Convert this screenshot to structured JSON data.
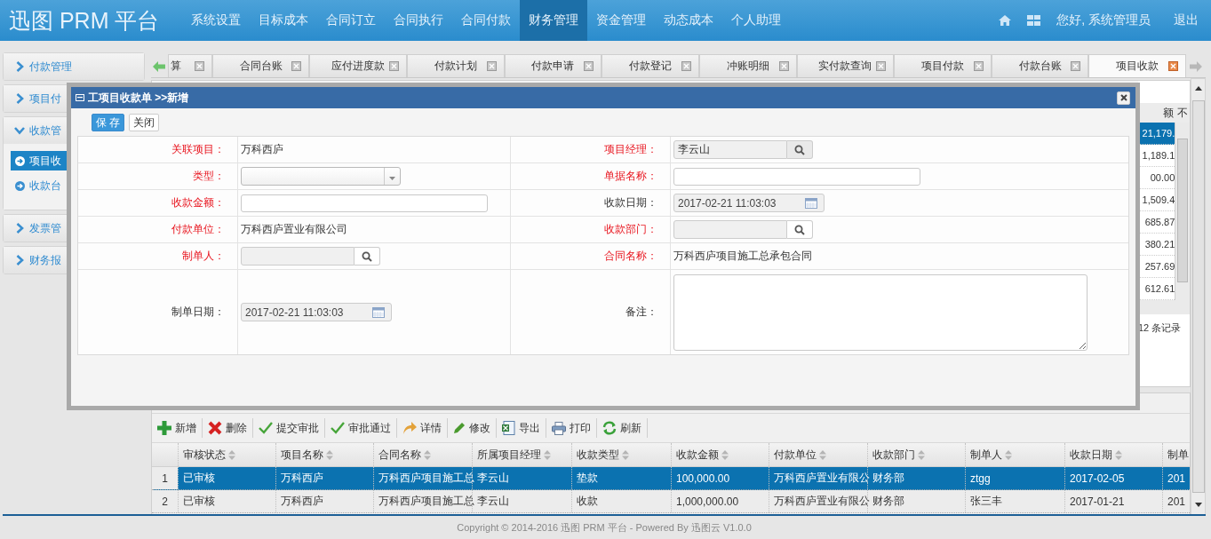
{
  "header": {
    "logo": "迅图 PRM 平台",
    "nav": [
      {
        "label": "系统设置",
        "selected": false
      },
      {
        "label": "目标成本",
        "selected": false
      },
      {
        "label": "合同订立",
        "selected": false
      },
      {
        "label": "合同执行",
        "selected": false
      },
      {
        "label": "合同付款",
        "selected": false
      },
      {
        "label": "财务管理",
        "selected": true
      },
      {
        "label": "资金管理",
        "selected": false
      },
      {
        "label": "动态成本",
        "selected": false
      },
      {
        "label": "个人助理",
        "selected": false
      }
    ],
    "greeting": "您好, 系统管理员",
    "logout": "退出"
  },
  "sidebar": [
    {
      "label": "付款管理",
      "expanded": false
    },
    {
      "label": "项目付",
      "expanded": false
    },
    {
      "label": "收款管",
      "expanded": true,
      "children": [
        {
          "label": "项目收",
          "selected": true
        },
        {
          "label": "收款台",
          "selected": false
        }
      ]
    },
    {
      "label": "发票管",
      "expanded": false
    },
    {
      "label": "财务报",
      "expanded": false
    }
  ],
  "tabs": [
    {
      "label": "算",
      "selected": false
    },
    {
      "label": "合同台账",
      "selected": false
    },
    {
      "label": "应付进度款",
      "selected": false
    },
    {
      "label": "付款计划",
      "selected": false
    },
    {
      "label": "付款申请",
      "selected": false
    },
    {
      "label": "付款登记",
      "selected": false
    },
    {
      "label": "冲账明细",
      "selected": false
    },
    {
      "label": "实付款查询",
      "selected": false
    },
    {
      "label": "项目付款",
      "selected": false
    },
    {
      "label": "付款台账",
      "selected": false
    },
    {
      "label": "项目收款",
      "selected": true
    }
  ],
  "upper_grid": {
    "column_1": "额",
    "column_2": "不",
    "rows": [
      {
        "value": "21,179.",
        "selected": true
      },
      {
        "value": "1,189.1",
        "selected": false
      },
      {
        "value": "00.00",
        "selected": false
      },
      {
        "value": "1,509.4",
        "selected": false
      },
      {
        "value": "685.87",
        "selected": false
      },
      {
        "value": "380.21",
        "selected": false
      },
      {
        "value": "257.69",
        "selected": false
      },
      {
        "value": "612.61",
        "selected": false
      }
    ],
    "pager": "12 条记录"
  },
  "lower_panel": {
    "toolbar": [
      {
        "label": "新增",
        "kind": "add"
      },
      {
        "label": "删除",
        "kind": "delete"
      },
      {
        "label": "提交审批",
        "kind": "submit"
      },
      {
        "label": "审批通过",
        "kind": "approve"
      },
      {
        "label": "详情",
        "kind": "details"
      },
      {
        "label": "修改",
        "kind": "edit"
      },
      {
        "label": "导出",
        "kind": "export"
      },
      {
        "label": "打印",
        "kind": "print"
      },
      {
        "label": "刷新",
        "kind": "refresh"
      }
    ],
    "columns": [
      "审核状态",
      "项目名称",
      "合同名称",
      "所属项目经理",
      "收款类型",
      "收款金额",
      "付款单位",
      "收款部门",
      "制单人",
      "收款日期",
      "制单"
    ],
    "rows": [
      {
        "number": "1",
        "selected": true,
        "cells": [
          "已审核",
          "万科西庐",
          "万科西庐项目施工总",
          "李云山",
          "垫款",
          "100,000.00",
          "万科西庐置业有限公",
          "财务部",
          "ztgg",
          "2017-02-05",
          "201"
        ]
      },
      {
        "number": "2",
        "selected": false,
        "cells": [
          "已审核",
          "万科西庐",
          "万科西庐项目施工总",
          "李云山",
          "收款",
          "1,000,000.00",
          "万科西庐置业有限公",
          "财务部",
          "张三丰",
          "2017-01-21",
          "201"
        ]
      }
    ]
  },
  "dialog": {
    "title": "工项目收款单 >>新增",
    "buttons": [
      {
        "label": "保 存",
        "kind": "primary"
      },
      {
        "label": "关闭",
        "kind": "plain"
      }
    ],
    "rows": [
      [
        {
          "label": "关联项目：",
          "required": true,
          "kind": "text",
          "value": "万科西庐"
        },
        {
          "label": "项目经理：",
          "required": true,
          "kind": "lookup",
          "value": "李云山"
        }
      ],
      [
        {
          "label": "类型：",
          "required": true,
          "kind": "select"
        },
        {
          "label": "单据名称：",
          "required": true,
          "kind": "input"
        }
      ],
      [
        {
          "label": "收款金额：",
          "required": true,
          "kind": "input"
        },
        {
          "label": "收款日期：",
          "required": false,
          "kind": "date",
          "value": "2017-02-21 11:03:03"
        }
      ],
      [
        {
          "label": "付款单位：",
          "required": true,
          "kind": "text",
          "value": "万科西庐置业有限公司"
        },
        {
          "label": "收款部门：",
          "required": true,
          "kind": "lookup"
        }
      ],
      [
        {
          "label": "制单人：",
          "required": true,
          "kind": "lookup"
        },
        {
          "label": "合同名称：",
          "required": true,
          "kind": "text",
          "value": "万科西庐项目施工总承包合同"
        }
      ],
      [
        {
          "label": "制单日期：",
          "required": false,
          "kind": "date",
          "value": "2017-02-21 11:03:03"
        },
        {
          "label": "备注：",
          "required": false,
          "kind": "textarea"
        }
      ]
    ]
  },
  "footer": "Copyright © 2014-2016 迅图 PRM 平台 - Powered By 迅图云 V1.0.0"
}
